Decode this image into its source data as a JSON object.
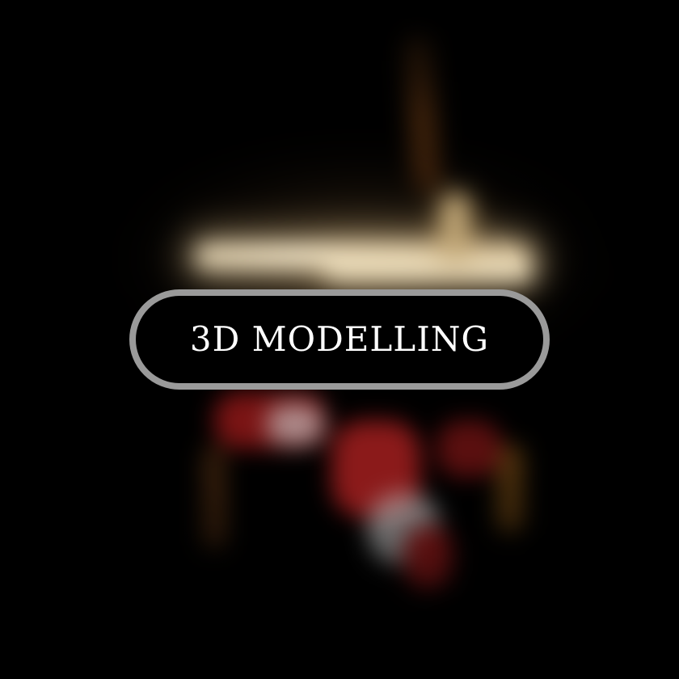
{
  "button": {
    "label": "3D MODELLING"
  },
  "colors": {
    "background": "#000000",
    "button_border": "#9a9a9a",
    "button_fill": "#000000",
    "button_text": "#ffffff",
    "glow": "#f0e3c6",
    "accent_red": "#8b1a1a"
  }
}
